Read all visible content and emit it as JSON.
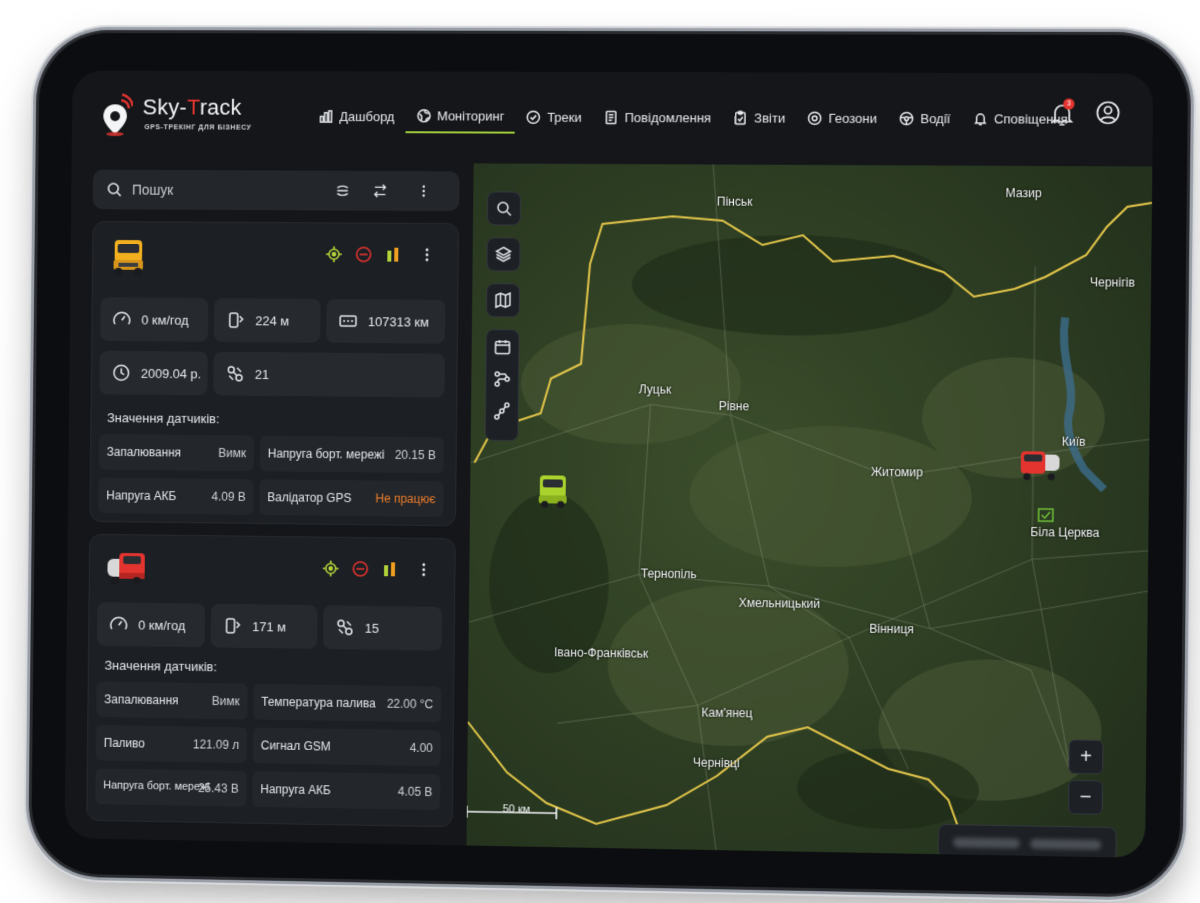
{
  "brand": {
    "name_prefix": "Sky-",
    "name_accent": "T",
    "name_suffix": "rack",
    "tagline": "GPS-ТРЕКІНГ ДЛЯ БІЗНЕСУ",
    "accent_color": "#e3342f",
    "highlight_color": "#9fca3b"
  },
  "nav": {
    "items": [
      {
        "label": "Дашборд",
        "icon": "bar-chart-icon"
      },
      {
        "label": "Моніторинг",
        "icon": "globe-icon",
        "active": true
      },
      {
        "label": "Треки",
        "icon": "check-circle-icon"
      },
      {
        "label": "Повідомлення",
        "icon": "document-icon"
      },
      {
        "label": "Звіти",
        "icon": "clipboard-icon"
      },
      {
        "label": "Геозони",
        "icon": "location-pin-icon"
      },
      {
        "label": "Водії",
        "icon": "steering-wheel-icon"
      },
      {
        "label": "Сповіщення",
        "icon": "bell-icon"
      }
    ],
    "notifications_count": "3"
  },
  "search": {
    "placeholder": "Пошук"
  },
  "units": [
    {
      "icon": "yellow-truck-icon",
      "tiles": [
        {
          "icon": "speedometer-icon",
          "value": "0 км/год"
        },
        {
          "icon": "distance-icon",
          "value": "224 м"
        },
        {
          "icon": "odometer-icon",
          "value": "107313 км"
        },
        {
          "icon": "clock-icon",
          "value": "2009.04 р."
        },
        {
          "icon": "satellite-icon",
          "value": "21"
        }
      ],
      "sensors_title": "Значення датчиків:",
      "sensors": [
        {
          "key": "Запалювання",
          "value": "Вимк"
        },
        {
          "key": "Напруга борт. мережі",
          "value": "20.15 В"
        },
        {
          "key": "Напруга АКБ",
          "value": "4.09 В"
        },
        {
          "key": "Валідатор GPS",
          "value": "Не працює"
        }
      ]
    },
    {
      "icon": "red-truck-icon",
      "tiles": [
        {
          "icon": "speedometer-icon",
          "value": "0 км/год"
        },
        {
          "icon": "distance-icon",
          "value": "171 м"
        },
        {
          "icon": "satellite-icon",
          "value": "15"
        }
      ],
      "sensors_title": "Значення датчиків:",
      "sensors": [
        {
          "key": "Запалювання",
          "value": "Вимк"
        },
        {
          "key": "Температура палива",
          "value": "22.00 °C"
        },
        {
          "key": "Паливо",
          "value": "121.09 л"
        },
        {
          "key": "Сигнал GSM",
          "value": "4.00"
        },
        {
          "key": "Напруга борт. мережі",
          "value": "25.43 В"
        },
        {
          "key": "Напруга АКБ",
          "value": "4.05 В"
        }
      ]
    }
  ],
  "map": {
    "cities": [
      "Пінськ",
      "Мазир",
      "Чернігів",
      "Луцьк",
      "Рівне",
      "Київ",
      "Житомир",
      "Біла Церква",
      "Тернопіль",
      "Хмельницький",
      "Вінниця",
      "Івано-Франківськ",
      "Кам'янец",
      "Чернівці"
    ],
    "scale_label": "50 км",
    "zoom_in": "+",
    "zoom_out": "−"
  }
}
